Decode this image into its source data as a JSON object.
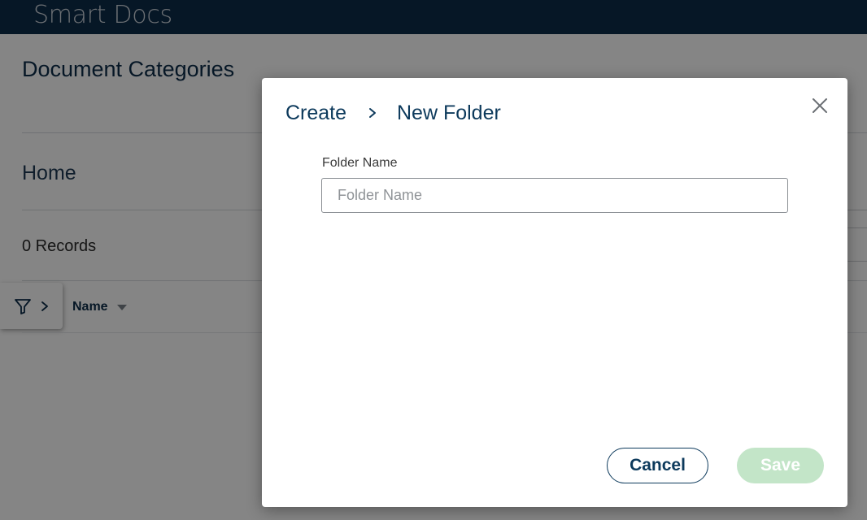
{
  "header": {
    "app_title": "Smart Docs"
  },
  "page": {
    "title": "Document Categories",
    "breadcrumb_home": "Home",
    "records_count": "0 Records",
    "table": {
      "columns": [
        "Name"
      ]
    }
  },
  "modal": {
    "breadcrumb": {
      "parent": "Create",
      "current": "New Folder"
    },
    "field": {
      "label": "Folder Name",
      "placeholder": "Folder Name",
      "value": ""
    },
    "buttons": {
      "cancel": "Cancel",
      "save": "Save"
    }
  },
  "icons": {
    "filter": "filter-icon",
    "expand": "chevron-right-icon",
    "sort": "caret-down-icon",
    "breadcrumb_separator": "chevron-right-icon",
    "close": "close-icon"
  },
  "colors": {
    "header_bg": "#0d2c49",
    "primary": "#0d3a5c",
    "save_disabled": "#c3e5c8"
  }
}
